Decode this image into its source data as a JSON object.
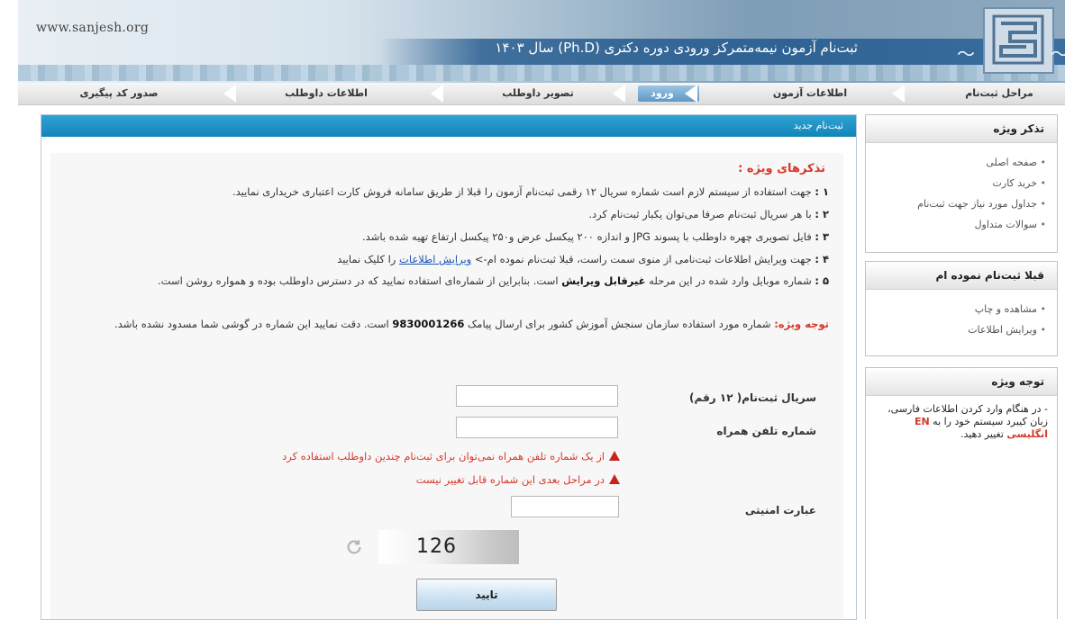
{
  "header": {
    "site_url": "www.sanjesh.org",
    "title": "ثبت‌نام آزمون نیمه‌متمرکز ورودی دوره دکتری (Ph.D) سال ۱۴۰۳"
  },
  "steps": [
    {
      "label": "مراحل ثبت‌نام"
    },
    {
      "label": "اطلاعات آزمون"
    },
    {
      "label": "ورود"
    },
    {
      "label": "تصویر داوطلب"
    },
    {
      "label": "اطلاعات داوطلب"
    },
    {
      "label": "صدور کد پیگیری"
    }
  ],
  "main": {
    "title": "ثبت‌نام جدید",
    "notes_title": "تذکرهای ویژه :",
    "notes": [
      {
        "num": "۱ :",
        "text": "جهت استفاده از سیستم لازم است شماره سریال ۱۲ رقمی ثبت‌نام آزمون را قبلا از طریق سامانه فروش کارت اعتباری خریداری نمایید."
      },
      {
        "num": "۲ :",
        "text": "با هر سریال ثبت‌نام صرفا می‌توان یکبار ثبت‌نام کرد."
      },
      {
        "num": "۳ :",
        "text": "فایل تصویری چهره داوطلب با پسوند JPG و اندازه ۲۰۰ پیکسل عرض و۲۵۰ پیکسل ارتفاع تهیه شده باشد."
      },
      {
        "num": "۴ :",
        "text_before": "جهت ویرایش اطلاعات ثبت‌نامی از منوی سمت راست، قبلا ثبت‌نام نموده ام-> ",
        "link": "ویرایش اطلاعات",
        "text_after": " را کلیک نمایید"
      },
      {
        "num": "۵ :",
        "text_before": "شماره موبایل وارد شده در این مرحله ",
        "emph": "غیرقابل ویرایش",
        "text_after": " است. بنابراین از شماره‌ای استفاده نمایید که در دسترس داوطلب بوده و همواره روشن است."
      },
      {
        "label": "توجه ویژه:",
        "text_before": " شماره مورد استفاده سازمان سنجش آموزش کشور برای ارسال پیامک ",
        "number": "9830001266",
        "text_after": " است. دقت نمایید این شماره در گوشی شما مسدود نشده باشد."
      }
    ],
    "form": {
      "serial_label": "سریال ثبت‌نام( ۱۲ رقم)",
      "serial_value": "",
      "phone_label": "شماره تلفن همراه",
      "phone_value": "",
      "warning_1": "از یک شماره تلفن همراه نمی‌توان برای ثبت‌نام چندین داوطلب استفاده کرد",
      "warning_2": "در مراحل بعدی این شماره قابل تغییر نیست",
      "security_label": "عبارت امنیتی",
      "security_value": "",
      "captcha_text": "126",
      "submit_label": "تایید"
    }
  },
  "sidebar": {
    "reminder": {
      "title": "تذکر ویژه",
      "items": [
        "صفحه اصلی",
        "خرید کارت",
        "جداول مورد نیاز جهت ثبت‌نام",
        "سوالات متداول"
      ]
    },
    "registered": {
      "title": "قبلا ثبت‌نام نموده ام",
      "items": [
        "مشاهده و چاپ",
        "ویرایش اطلاعات"
      ]
    },
    "tip": {
      "title": "توجه ویژه",
      "text_before": "- در هنگام وارد کردن اطلاعات فارسی، زبان کیبرد سیستم خود را به ",
      "highlight": "EN انگلیسی",
      "text_after": " تغییر دهید."
    }
  },
  "colors": {
    "title_bar": "#1a8fc4",
    "warning_red": "#d6382b",
    "link_blue": "#1d56b8",
    "header_blue": "#2f6394"
  }
}
